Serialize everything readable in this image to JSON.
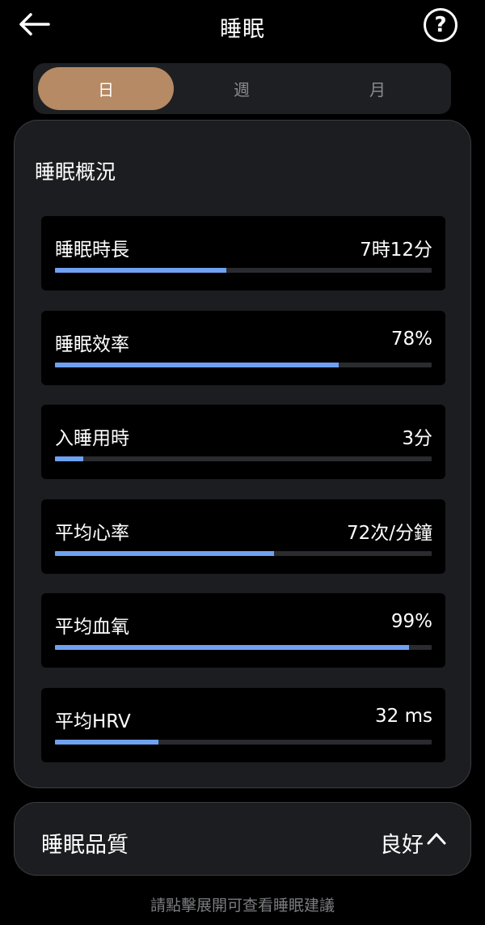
{
  "header": {
    "title": "睡眠",
    "back_icon": "arrow-left-icon",
    "help_label": "?"
  },
  "tabs": [
    {
      "label": "日",
      "active": true
    },
    {
      "label": "週",
      "active": false
    },
    {
      "label": "月",
      "active": false
    }
  ],
  "overview": {
    "title": "睡眠概況",
    "metrics": [
      {
        "label": "睡眠時長",
        "value": "7時12分",
        "progress": 0.455
      },
      {
        "label": "睡眠效率",
        "value": "78%",
        "progress": 0.753
      },
      {
        "label": "入睡用時",
        "value": "3分",
        "progress": 0.075
      },
      {
        "label": "平均心率",
        "value": "72次/分鐘",
        "progress": 0.582
      },
      {
        "label": "平均血氧",
        "value": "99%",
        "progress": 0.94
      },
      {
        "label": "平均HRV",
        "value": "32 ms",
        "progress": 0.275
      }
    ]
  },
  "quality": {
    "label": "睡眠品質",
    "value": "良好",
    "expand_icon": "chevron-up-icon"
  },
  "hint": "請點擊展開可查看睡眠建議",
  "colors": {
    "background": "#000000",
    "card": "#1c1d20",
    "accent_tab": "#b58a64",
    "progress_fill": "#6fa1f2",
    "progress_track": "#2a2b2f"
  }
}
